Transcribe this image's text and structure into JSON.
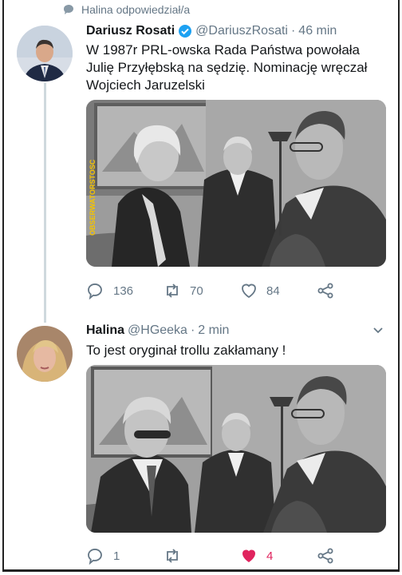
{
  "context": {
    "text": "Halina odpowiedział/a",
    "icon": "bubble-icon"
  },
  "tweets": [
    {
      "name": "Dariusz Rosati",
      "verified": true,
      "handle": "@DariuszRosati",
      "dot": "·",
      "time": "46 min",
      "text": "W 1987r  PRL-owska Rada Państwa powołała Julię Przyłębską na sędzię. Nominację wręczał Wojciech Jaruzelski",
      "watermark": "OBSERWATORSTOSC",
      "actions": {
        "replies": "136",
        "retweets": "70",
        "likes": "84"
      }
    },
    {
      "name": "Halina",
      "verified": false,
      "handle": "@HGeeka",
      "dot": "·",
      "time": "2 min",
      "text": "To jest oryginał trollu zakłamany !",
      "actions": {
        "replies": "1",
        "retweets": "",
        "likes": "4",
        "liked": true
      }
    }
  ],
  "colors": {
    "text": "#14171a",
    "secondary": "#657786",
    "verified": "#1da1f2",
    "like": "#e0245e",
    "thread": "#cfd9de"
  }
}
